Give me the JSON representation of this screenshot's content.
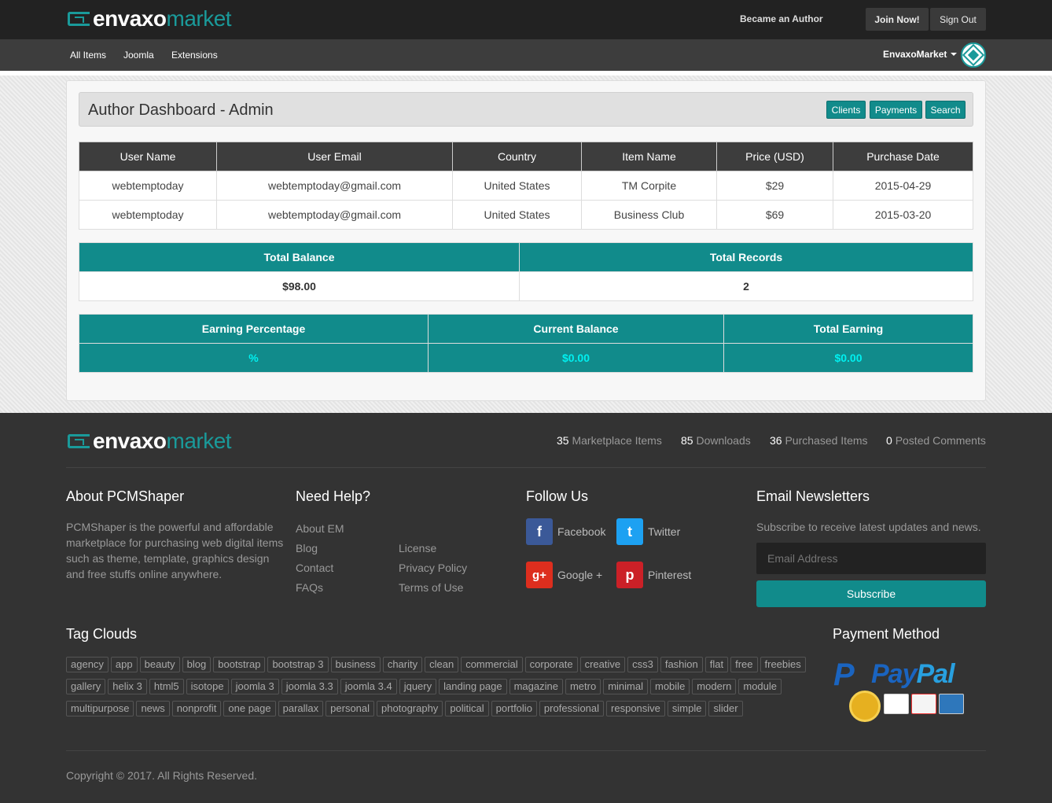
{
  "brand": {
    "name_bold": "envaxo",
    "name_light": "market"
  },
  "topbar": {
    "author_link": "Became an Author",
    "join": "Join Now!",
    "signout": "Sign Out"
  },
  "nav": {
    "items": [
      "All Items",
      "Joomla",
      "Extensions"
    ],
    "account": "EnvaxoMarket"
  },
  "dashboard": {
    "title": "Author Dashboard - Admin",
    "buttons": {
      "clients": "Clients",
      "payments": "Payments",
      "search": "Search"
    },
    "columns": [
      "User Name",
      "User Email",
      "Country",
      "Item Name",
      "Price (USD)",
      "Purchase Date"
    ],
    "rows": [
      [
        "webtemptoday",
        "webtemptoday@gmail.com",
        "United States",
        "TM Corpite",
        "$29",
        "2015-04-29"
      ],
      [
        "webtemptoday",
        "webtemptoday@gmail.com",
        "United States",
        "Business Club",
        "$69",
        "2015-03-20"
      ]
    ],
    "balance": {
      "label_total": "Total Balance",
      "label_records": "Total Records",
      "total": "$98.00",
      "records": "2"
    },
    "earnings": {
      "label_percent": "Earning Percentage",
      "label_current": "Current Balance",
      "label_total": "Total Earning",
      "percent": "%",
      "current": "$0.00",
      "total": "$0.00"
    }
  },
  "footer": {
    "stats": [
      {
        "count": "35",
        "label": "Marketplace Items"
      },
      {
        "count": "85",
        "label": "Downloads"
      },
      {
        "count": "36",
        "label": "Purchased Items"
      },
      {
        "count": "0",
        "label": "Posted Comments"
      }
    ],
    "about": {
      "heading": "About PCMShaper",
      "text": "PCMShaper is the powerful and affordable marketplace for purchasing web digital items such as theme, template, graphics design and free stuffs online anywhere."
    },
    "help": {
      "heading": "Need Help?",
      "col1": [
        "About EM",
        "Blog",
        "Contact",
        "FAQs"
      ],
      "col2": [
        "License",
        "Privacy Policy",
        "Terms of Use"
      ]
    },
    "follow": {
      "heading": "Follow Us",
      "facebook": "Facebook",
      "twitter": "Twitter",
      "google": "Google +",
      "pinterest": "Pinterest"
    },
    "newsletter": {
      "heading": "Email Newsletters",
      "text": "Subscribe to receive latest updates and news.",
      "placeholder": "Email Address",
      "button": "Subscribe"
    },
    "tags_heading": "Tag Clouds",
    "tags": [
      "agency",
      "app",
      "beauty",
      "blog",
      "bootstrap",
      "bootstrap 3",
      "business",
      "charity",
      "clean",
      "commercial",
      "corporate",
      "creative",
      "css3",
      "fashion",
      "flat",
      "free",
      "freebies",
      "gallery",
      "helix 3",
      "html5",
      "isotope",
      "joomla 3",
      "joomla 3.3",
      "joomla 3.4",
      "jquery",
      "landing page",
      "magazine",
      "metro",
      "minimal",
      "mobile",
      "modern",
      "module",
      "multipurpose",
      "news",
      "nonprofit",
      "one page",
      "parallax",
      "personal",
      "photography",
      "political",
      "portfolio",
      "professional",
      "responsive",
      "simple",
      "slider"
    ],
    "payment_heading": "Payment Method",
    "paypal": {
      "pay": "Pay",
      "pal": "Pal"
    },
    "copyright": "Copyright © 2017. All Rights Reserved."
  }
}
